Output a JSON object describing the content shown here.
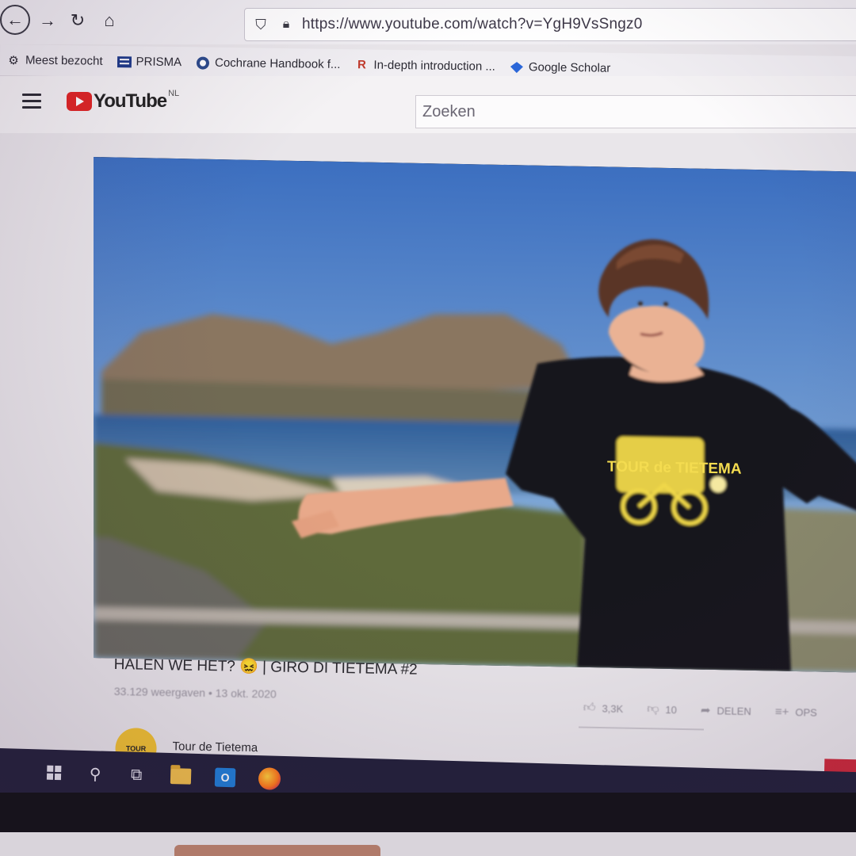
{
  "browser": {
    "url": "https://www.youtube.com/watch?v=YgH9VsSngz0",
    "nav_icons": [
      "back-arrow-icon",
      "forward-arrow-icon",
      "reload-icon",
      "home-icon"
    ],
    "bookmarks": [
      {
        "label": "Meest bezocht",
        "icon": "gear-icon"
      },
      {
        "label": "PRISMA",
        "icon": "prisma-logo-icon"
      },
      {
        "label": "Cochrane Handbook f...",
        "icon": "cochrane-icon"
      },
      {
        "label": "In-depth introduction ...",
        "icon": "r-logo-icon"
      },
      {
        "label": "Google Scholar",
        "icon": "scholar-icon"
      }
    ]
  },
  "youtube": {
    "logo_text": "YouTube",
    "region": "NL",
    "search_placeholder": "Zoeken",
    "brand_color": "#e02424"
  },
  "video": {
    "title": "HALEN WE HET? 😖 | GIRO DI TIETEMA #2",
    "views": "33.129 weergaven",
    "separator": "•",
    "date": "13 okt. 2020",
    "likes": "3,3K",
    "dislikes": "10",
    "share_label": "DELEN",
    "save_label": "OPS",
    "shirt_text": "TOUR de TIETEMA"
  },
  "channel": {
    "name": "Tour de Tietema",
    "avatar_text": "TOUR"
  },
  "taskbar": {
    "items": [
      "windows-start-icon",
      "search-icon",
      "task-view-icon",
      "file-explorer-icon",
      "outlook-icon",
      "firefox-icon"
    ]
  }
}
